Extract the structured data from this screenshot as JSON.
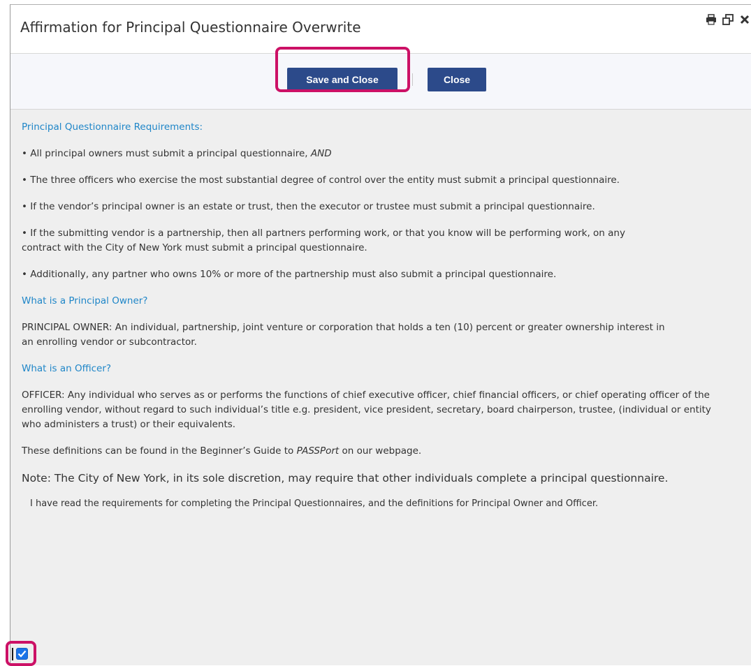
{
  "dialog": {
    "title": "Affirmation for Principal Questionnaire Overwrite",
    "icons": [
      "printer-icon",
      "restore-window-icon",
      "close-icon"
    ]
  },
  "toolbar": {
    "save_label": "Save and Close",
    "close_label": "Close"
  },
  "content": {
    "req_heading": "Principal Questionnaire Requirements:",
    "bullet1_text": "• All principal owners must submit a principal questionnaire,",
    "bullet1_emph": "AND",
    "bullet2": "• The three officers who exercise the most substantial degree of control over the entity must submit a principal questionnaire.",
    "bullet3": "• If the vendor’s principal owner is an estate or trust, then the executor or trustee must submit a principal questionnaire.",
    "bullet4": "• If the submitting vendor is a partnership, then all partners performing work, or that you know will be performing work, on any contract with the City of New York must submit a principal questionnaire.",
    "bullet5": "• Additionally, any partner who owns 10% or more of the partnership must also submit a principal questionnaire.",
    "owner_heading": "What is a Principal Owner?",
    "owner_def": "PRINCIPAL OWNER: An individual, partnership, joint venture or corporation that holds a ten (10) percent or greater ownership interest in an enrolling vendor or subcontractor.",
    "officer_heading": "What is an Officer?",
    "officer_def": "OFFICER: Any individual who serves as or performs the functions of chief executive officer, chief financial officers, or chief operating officer of the enrolling vendor, without regard to such individual’s title e.g. president, vice president, secretary, board chairperson, trustee, (individual or entity who administers a trust) or their equivalents.",
    "guide_before": "These definitions can be found in the Beginner’s Guide to",
    "guide_emph": "PASSPort",
    "guide_after": "on our webpage.",
    "note": "Note: The City of New York, in its sole discretion, may require that other individuals complete a principal questionnaire.",
    "ack": "I have read the requirements for completing the Principal Questionnaires, and the definitions for Principal Owner and Officer."
  },
  "checkbox": {
    "checked": true
  },
  "colors": {
    "button": "#2c4a8a",
    "heading": "#1f86c8",
    "highlight": "#cc1166",
    "checkbox": "#1a73e8"
  }
}
